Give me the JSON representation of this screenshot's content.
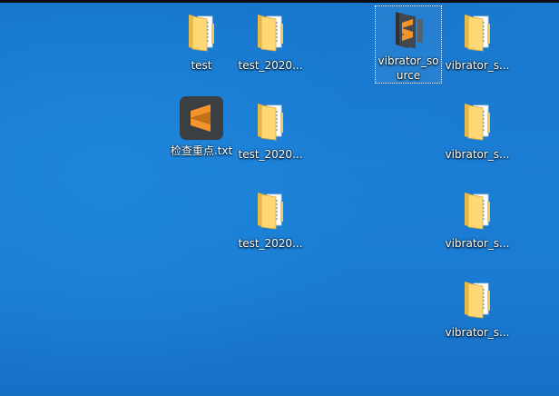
{
  "desktop": {
    "icons": [
      {
        "label": "test",
        "type": "folder"
      },
      {
        "label": "test_2020...",
        "type": "folder"
      },
      {
        "label": "vibrator_source",
        "type": "folder-sublime"
      },
      {
        "label": "vibrator_s...",
        "type": "folder"
      },
      {
        "label": "检查重点.txt",
        "type": "sublime-app"
      },
      {
        "label": "test_2020...",
        "type": "folder"
      },
      {
        "label": "vibrator_s...",
        "type": "folder"
      },
      {
        "label": "test_2020...",
        "type": "folder"
      },
      {
        "label": "vibrator_s...",
        "type": "folder"
      },
      {
        "label": "vibrator_s...",
        "type": "folder"
      }
    ]
  },
  "colors": {
    "wallpaper": "#1b7bd3",
    "folder_front": "#ffd873",
    "folder_back": "#e9b94a",
    "sublime_orange": "#f5942a",
    "sublime_dark": "#3b3e43"
  }
}
